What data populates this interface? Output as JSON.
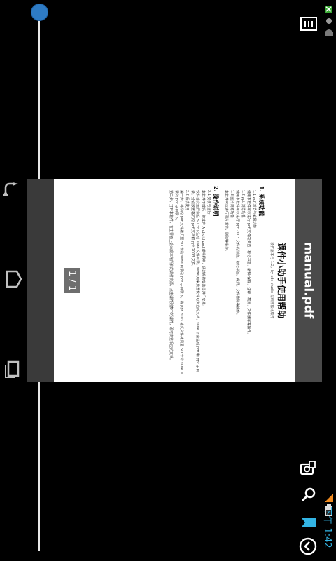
{
  "document": {
    "filename": "manual.pdf",
    "page_indicator": "1 / 1",
    "page": {
      "title": "课件小助手使用帮助",
      "subtitle": "软件版本号 1.2，by sdc studio 深圳市松讯软件",
      "sections": [
        {
          "heading": "1. 系统功能",
          "paragraphs": [
            "1.1 pdf 浏览与编辑功能",
            "使用本软件可以进行 pdf 文件的浏览，标记书签，编辑(保存，注释，截屏，文件删除等操作。",
            "1.2 ppt 浏览功能",
            "使用本软件可以进行 ppt 2003 文件的浏览，标记书签，截屏，文件删除等操作。",
            "1.3 图片浏览功能",
            "本软件可以进行图片浏览，删除等操作。"
          ]
        },
        {
          "heading": "2. 操作说明",
          "paragraphs": [
            "2.1 安装与运行",
            "本软件下载后，将其在 Android pad 或手机中，通过系统安装器进行安装。",
            "软件首次运行会在 SD 卡下生成 slide 文件目录，slide 用来放置软件可浏览的文档，slide 下会生成 pdf 和 ppt 子目录，分别放置格式的 pdf 文档和 ppt 2003 文件。",
            "2.2 系统使用",
            "第一步，将你的 pdf 文件拷贝至 SD 卡的 slide 目录的 pdf 子目录下，将 ppt 2003 格式文件拷贝至 SD 卡的 slide 目录的 ppt 子目录下。",
            "第二步，打开本软件，在主界面上会出现本地所有的课件资源，点击课件列表中的课件，即可浏览相应的文档。"
          ]
        }
      ]
    }
  },
  "status_bar": {
    "time": "下午 1:42"
  },
  "colors": {
    "slider_thumb": "#2e7bc4",
    "clock": "#33b5e5",
    "doc_frame": "#3a3a3a"
  },
  "icons": {
    "nav_back": "back-arrow-icon",
    "nav_home": "home-icon",
    "nav_recent": "recent-apps-icon",
    "menu": "grid-menu-icon",
    "screenshot": "screenshot-icon",
    "search": "search-icon",
    "bookmark": "bookmark-icon",
    "back": "back-circle-icon"
  },
  "slider": {
    "value": 0
  }
}
